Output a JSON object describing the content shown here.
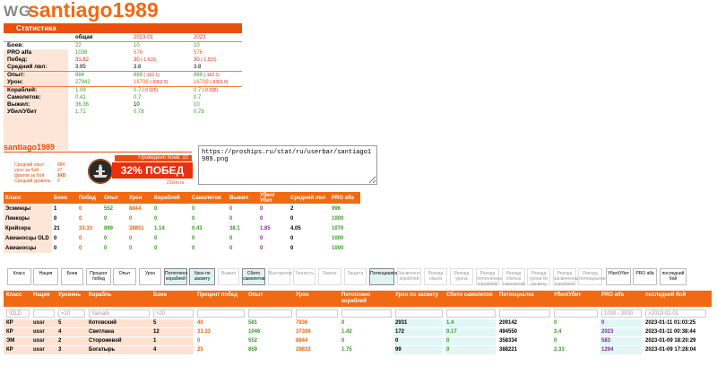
{
  "header": {
    "wg": "WG",
    "nickname": "santiago1989"
  },
  "stats": {
    "title": "Статистика",
    "columns": [
      "общая",
      "2023-01",
      "2023"
    ],
    "rows": [
      {
        "label": "Боев:",
        "v": [
          "22",
          "10",
          "10"
        ]
      },
      {
        "label": "PRO alfa",
        "v": [
          "1036",
          "576",
          "576"
        ]
      },
      {
        "label": "Побед:",
        "v": [
          "31.82",
          "30",
          "30"
        ],
        "d": [
          "",
          "(-1.515)",
          "(-1.515)"
        ]
      },
      {
        "label": "Средний лвл:",
        "v": [
          "3.95",
          "3.8",
          "3.8"
        ]
      },
      {
        "label": "Опыт:",
        "v": [
          "884",
          "889",
          "889"
        ],
        "d": [
          "",
          "(-162.1)",
          "(-162.1)"
        ]
      },
      {
        "label": "Урон:",
        "v": [
          "27942",
          "16709",
          "16709"
        ],
        "d": [
          "",
          "(-9363.9)",
          "(-9363.9)"
        ]
      },
      {
        "label": "Кораблей:",
        "v": [
          "1.09",
          "0.7",
          "0.7"
        ],
        "d": [
          "",
          "(-0.326)",
          "(-0.326)"
        ]
      },
      {
        "label": "Самолетов:",
        "v": [
          "0.41",
          "0.7",
          "0.7"
        ]
      },
      {
        "label": "Выжил:",
        "v": [
          "36.36",
          "10",
          "10"
        ]
      },
      {
        "label": "Убил/Убит",
        "v": [
          "1.71",
          "0.78",
          "0.78"
        ]
      }
    ]
  },
  "userbar": {
    "nick": "santiago1989",
    "labels": [
      "Средний опыт:",
      "урон за бой:",
      "фрагов за бой:",
      "Средний уровень:"
    ],
    "values": [
      "884",
      "27 942",
      "1.09",
      "0"
    ],
    "battles": "Проведено боев: 22",
    "wins": "32% ПОБЕД",
    "site": "21soo.ru",
    "url": "https://proships.ru/stat/ru/userbar/santiago1989.png"
  },
  "class_table": {
    "headers": [
      "Класс",
      "Боев",
      "Побед",
      "Опыт",
      "Урон",
      "Кораблей",
      "Самолетов",
      "Выжил",
      "Убил/Убит",
      "Средний лвл",
      "PRO alfa"
    ],
    "rows": [
      [
        "Эсминцы",
        "1",
        "0",
        "552",
        "8844",
        "0",
        "0",
        "0",
        "0",
        "2",
        "996"
      ],
      [
        "Линкоры",
        "0",
        "0",
        "0",
        "0",
        "0",
        "0",
        "0",
        "0",
        "0",
        "1000"
      ],
      [
        "Крейсера",
        "21",
        "33.33",
        "899",
        "28851",
        "1.14",
        "0.43",
        "38.1",
        "1.85",
        "4.05",
        "1070"
      ],
      [
        "Авианосцы OLD",
        "0",
        "0",
        "0",
        "0",
        "0",
        "0",
        "0",
        "0",
        "0",
        "1000"
      ],
      [
        "Авианосцы",
        "0",
        "0",
        "0",
        "0",
        "0",
        "0",
        "0",
        "0",
        "0",
        "1000"
      ]
    ]
  },
  "filters": [
    {
      "label": "Класс",
      "state": "normal"
    },
    {
      "label": "Нация",
      "state": "normal"
    },
    {
      "label": "Боев",
      "state": "normal"
    },
    {
      "label": "Процент побед",
      "state": "normal"
    },
    {
      "label": "Опыт",
      "state": "normal"
    },
    {
      "label": "Урон",
      "state": "normal"
    },
    {
      "label": "Потоплено кораблей",
      "state": "active"
    },
    {
      "label": "Урон по засвету",
      "state": "active"
    },
    {
      "label": "Выжил",
      "state": "dim"
    },
    {
      "label": "Сбито самолетов",
      "state": "active"
    },
    {
      "label": "Выстрелов",
      "state": "dim"
    },
    {
      "label": "Точность",
      "state": "dim"
    },
    {
      "label": "Захват",
      "state": "dim"
    },
    {
      "label": "Защита",
      "state": "dim"
    },
    {
      "label": "Потенциалка",
      "state": "active"
    },
    {
      "label": "Засвечено кораблей",
      "state": "dim"
    },
    {
      "label": "Рекорд опыта",
      "state": "dim"
    },
    {
      "label": "Рекорд урона",
      "state": "dim"
    },
    {
      "label": "Рекорд потопленных кораблей",
      "state": "dim"
    },
    {
      "label": "Рекорд сбитых самолетов",
      "state": "dim"
    },
    {
      "label": "Рекорд урона по засвету",
      "state": "dim"
    },
    {
      "label": "Рекорд засвеченных кораблей",
      "state": "dim"
    },
    {
      "label": "Рекорд потенциалки",
      "state": "dim"
    },
    {
      "label": "Убил/Убит",
      "state": "normal"
    },
    {
      "label": "PRO alfa",
      "state": "normal"
    },
    {
      "label": "последний бой",
      "state": "normal"
    }
  ],
  "main_table": {
    "headers": [
      "Класс",
      "Нация",
      "Уровень",
      "Корабль",
      "Боев",
      "Процент побед",
      "Опыт",
      "Урон",
      "Потоплено кораблей",
      "Урон по засвету",
      "Сбито самолетов",
      "Потенциалка",
      "Убил/Убит",
      "PRO alfa",
      "последний бой"
    ],
    "filters": [
      "!OLD",
      "",
      "=10",
      "Yamato",
      ">20",
      "",
      "",
      "",
      "",
      "",
      "",
      "",
      "",
      "1000 - 3000",
      ">2019-01-01"
    ],
    "rows": [
      [
        "КР",
        "ussr",
        "5",
        "Котовский",
        "5",
        "40",
        "581",
        "7836",
        "0",
        "2931",
        "1.4",
        "209142",
        "0",
        "0",
        "2023-01-11 01:03:25"
      ],
      [
        "КР",
        "ussr",
        "4",
        "Светлана",
        "12",
        "33.33",
        "1046",
        "37306",
        "1.42",
        "172",
        "0.17",
        "494550",
        "3.4",
        "2023",
        "2023-01-11 00:38:44"
      ],
      [
        "ЭМ",
        "ussr",
        "2",
        "Сторожевой",
        "1",
        "0",
        "552",
        "8844",
        "0",
        "0",
        "0",
        "358334",
        "0",
        "583",
        "2023-01-09 18:20:29"
      ],
      [
        "КР",
        "ussr",
        "3",
        "Богатырь",
        "4",
        "25",
        "859",
        "29832",
        "1.75",
        "99",
        "0",
        "388221",
        "2.33",
        "1294",
        "2023-01-09 17:28:04"
      ]
    ]
  }
}
